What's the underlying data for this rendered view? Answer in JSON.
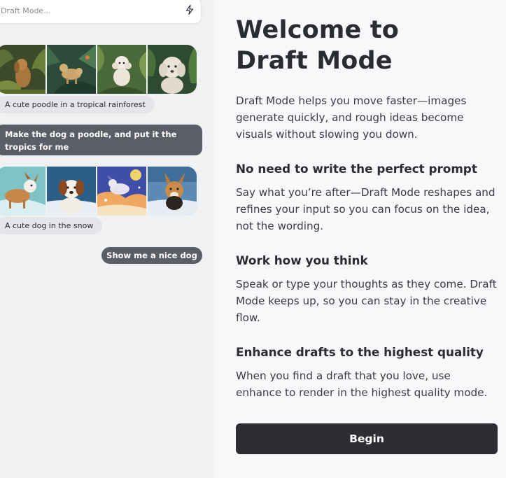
{
  "prompt": {
    "placeholder": "Draft Mode..."
  },
  "icons": {
    "prompt_action": "lightning-bolt-icon"
  },
  "chat": {
    "generation_1": {
      "caption": "A cute poodle in a tropical rainforest",
      "images": [
        "poodle-rainforest-1",
        "poodle-rainforest-2",
        "poodle-rainforest-3",
        "poodle-rainforest-4"
      ]
    },
    "user_message_1": "Make the dog a poodle, and put it the tropics for me",
    "generation_2": {
      "caption": "A cute dog in the snow",
      "images": [
        "dog-snow-1",
        "dog-snow-2",
        "dog-snow-3",
        "dog-snow-4"
      ]
    },
    "user_message_2": "Show me a nice dog"
  },
  "welcome": {
    "title_line1": "Welcome to",
    "title_line2": "Draft Mode",
    "intro": "Draft Mode helps you move faster—images generate quickly, and rough ideas become visuals without slowing you down.",
    "sections": [
      {
        "heading": "No need to write the perfect prompt",
        "body": "Say what you’re after—Draft Mode reshapes and refines your input so you can focus on the idea, not the wording."
      },
      {
        "heading": "Work how you think",
        "body": "Speak or type your thoughts as they come. Draft Mode keeps up, so you can stay in the creative flow."
      },
      {
        "heading": "Enhance drafts to the highest quality",
        "body": "When you find a draft that you love, use enhance to render in the highest quality mode."
      }
    ],
    "begin_label": "Begin"
  },
  "colors": {
    "left_panel_bg": "#f0f1f3",
    "right_panel_bg": "#f8f8fa",
    "user_bubble": "#5b5e67",
    "caption_bubble": "#e4e5e8",
    "begin_button": "#2c2e34"
  }
}
